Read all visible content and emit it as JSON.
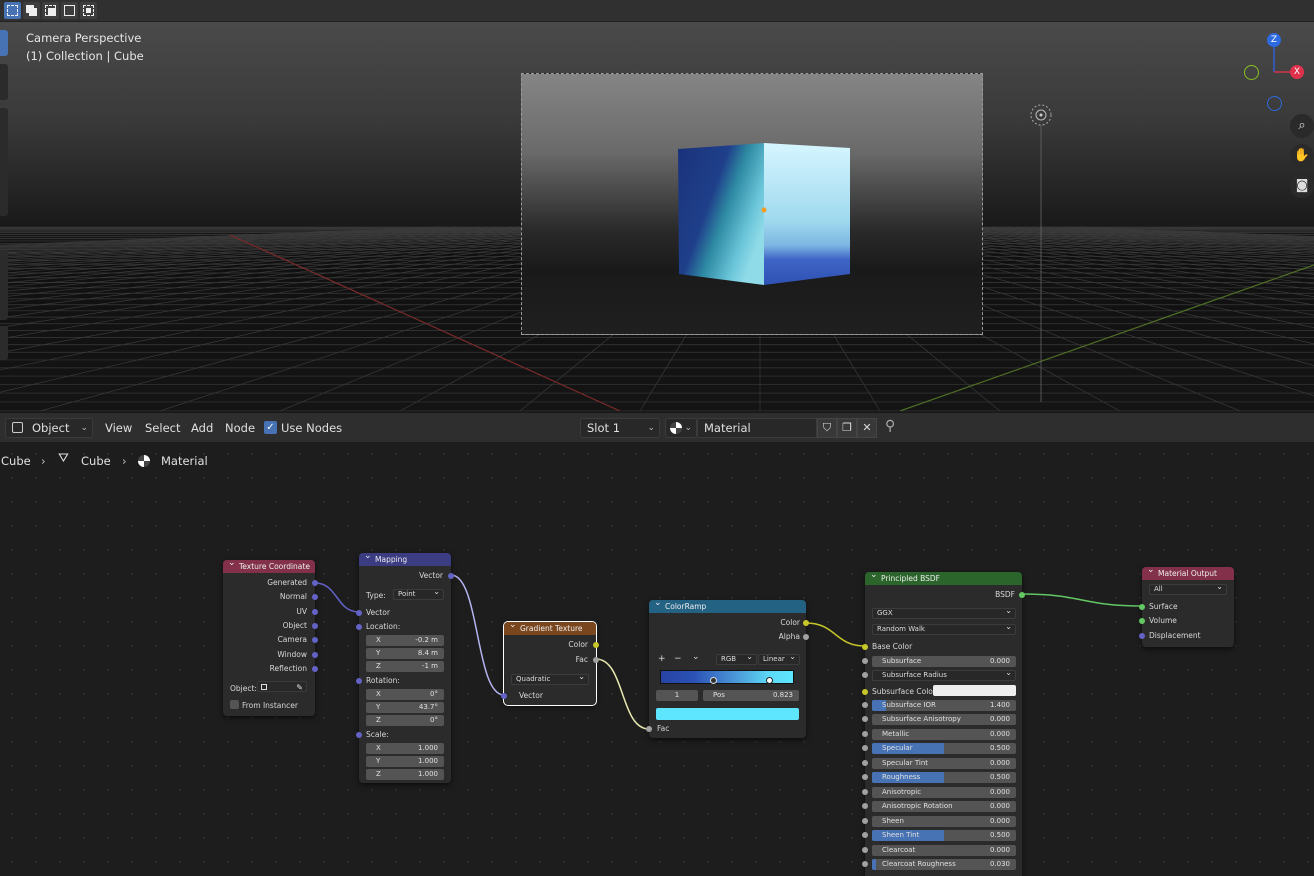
{
  "toolbar": {
    "modes": [
      "select-box",
      "extend",
      "subtract",
      "invert",
      "intersect"
    ]
  },
  "viewport": {
    "line1": "Camera Perspective",
    "line2": "(1) Collection | Cube",
    "gizmo": {
      "z": "Z",
      "x": "X"
    }
  },
  "header": {
    "editor_type": "Object",
    "menu": {
      "view": "View",
      "select": "Select",
      "add": "Add",
      "node": "Node"
    },
    "use_nodes_label": "Use Nodes",
    "slot": "Slot 1",
    "material": "Material"
  },
  "breadcrumb": {
    "object": "Cube",
    "mesh": "Cube",
    "material": "Material"
  },
  "nodes": {
    "texcoord": {
      "title": "Texture Coordinate",
      "outputs": [
        "Generated",
        "Normal",
        "UV",
        "Object",
        "Camera",
        "Window",
        "Reflection"
      ],
      "object_label": "Object:",
      "from_instancer": "From Instancer",
      "color": "#83314a"
    },
    "mapping": {
      "title": "Mapping",
      "output": "Vector",
      "type_label": "Type:",
      "type_value": "Point",
      "input_vector": "Vector",
      "location_label": "Location:",
      "location": [
        {
          "axis": "X",
          "value": "-0.2 m"
        },
        {
          "axis": "Y",
          "value": "8.4 m"
        },
        {
          "axis": "Z",
          "value": "-1 m"
        }
      ],
      "rotation_label": "Rotation:",
      "rotation": [
        {
          "axis": "X",
          "value": "0°"
        },
        {
          "axis": "Y",
          "value": "43.7°"
        },
        {
          "axis": "Z",
          "value": "0°"
        }
      ],
      "scale_label": "Scale:",
      "scale": [
        {
          "axis": "X",
          "value": "1.000"
        },
        {
          "axis": "Y",
          "value": "1.000"
        },
        {
          "axis": "Z",
          "value": "1.000"
        }
      ],
      "color": "#3c3c83"
    },
    "gradient": {
      "title": "Gradient Texture",
      "outputs": [
        "Color",
        "Fac"
      ],
      "type_value": "Quadratic",
      "input": "Vector",
      "color": "#79461d"
    },
    "colorramp": {
      "title": "ColorRamp",
      "outputs": [
        "Color",
        "Alpha"
      ],
      "plus": "+",
      "minus": "−",
      "down": "⌄",
      "mode": "RGB",
      "interp": "Linear",
      "stop_index": "1",
      "pos_label": "Pos",
      "pos_value": "0.823",
      "input": "Fac",
      "swatch_color": "#5ee6ff",
      "color": "#246283"
    },
    "bsdf": {
      "title": "Principled BSDF",
      "output": "BSDF",
      "distribution": "GGX",
      "subsurface_method": "Random Walk",
      "base_color_label": "Base Color",
      "subsurface_color_label": "Subsurface Color",
      "subsurface_radius_label": "Subsurface Radius",
      "params": [
        {
          "label": "Subsurface",
          "value": "0.000",
          "fill": 0
        },
        {
          "label": "Subsurface IOR",
          "value": "1.400",
          "fill": 0.1
        },
        {
          "label": "Subsurface Anisotropy",
          "value": "0.000",
          "fill": 0
        },
        {
          "label": "Metallic",
          "value": "0.000",
          "fill": 0
        },
        {
          "label": "Specular",
          "value": "0.500",
          "fill": 0.5
        },
        {
          "label": "Specular Tint",
          "value": "0.000",
          "fill": 0
        },
        {
          "label": "Roughness",
          "value": "0.500",
          "fill": 0.5
        },
        {
          "label": "Anisotropic",
          "value": "0.000",
          "fill": 0
        },
        {
          "label": "Anisotropic Rotation",
          "value": "0.000",
          "fill": 0
        },
        {
          "label": "Sheen",
          "value": "0.000",
          "fill": 0
        },
        {
          "label": "Sheen Tint",
          "value": "0.500",
          "fill": 0.5
        },
        {
          "label": "Clearcoat",
          "value": "0.000",
          "fill": 0
        },
        {
          "label": "Clearcoat Roughness",
          "value": "0.030",
          "fill": 0.03
        }
      ],
      "color": "#2b652b"
    },
    "output": {
      "title": "Material Output",
      "target": "All",
      "inputs": [
        "Surface",
        "Volume",
        "Displacement"
      ],
      "color": "#83314a"
    }
  }
}
